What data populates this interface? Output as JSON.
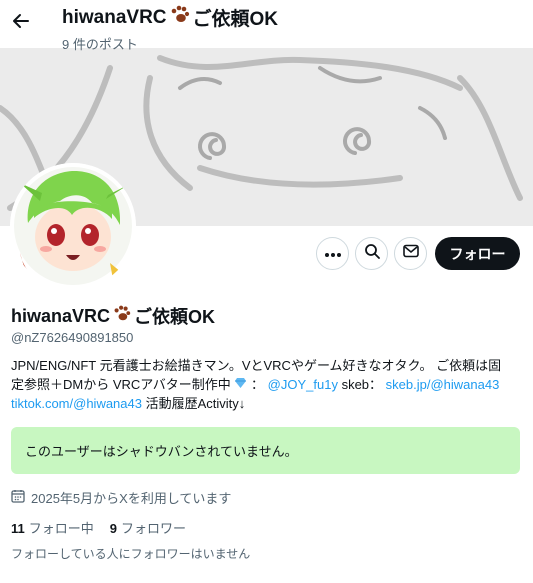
{
  "header": {
    "title_text": "hiwanaVRC",
    "title_suffix": "ご依頼OK",
    "post_count": "9 件のポスト"
  },
  "profile": {
    "name_text": "hiwanaVRC",
    "name_suffix": "ご依頼OK",
    "handle": "@nZ7626490891850",
    "bio": {
      "line1": "JPN/ENG/NFT 元看護士お絵描きマン。VとVRCやゲーム好きなオタク。 ご依頼は固",
      "line2_prefix": "定参照＋DMから VRCアバター制作中",
      "line2_colon": "：",
      "link1": "@JOY_fu1y",
      "line2_skeb": " skeb：",
      "link2": "skeb.jp/@hiwana43",
      "link3": "tiktok.com/@hiwana43",
      "line3_suffix": " 活動履歴Activity↓"
    },
    "notice": "このユーザーはシャドウバンされていません。",
    "joined": "2025年5月からXを利用しています",
    "following_count": "11",
    "following_label": "フォロー中",
    "followers_count": "9",
    "followers_label": "フォロワー",
    "mutual_note": "フォローしている人にフォロワーはいません"
  },
  "actions": {
    "follow_label": "フォロー",
    "more_icon": "more-icon",
    "search_icon": "search-icon",
    "message_icon": "mail-icon"
  },
  "colors": {
    "accent": "#1d9bf0",
    "follow_bg": "#0f1419",
    "notice_bg": "#c8f7c1"
  }
}
